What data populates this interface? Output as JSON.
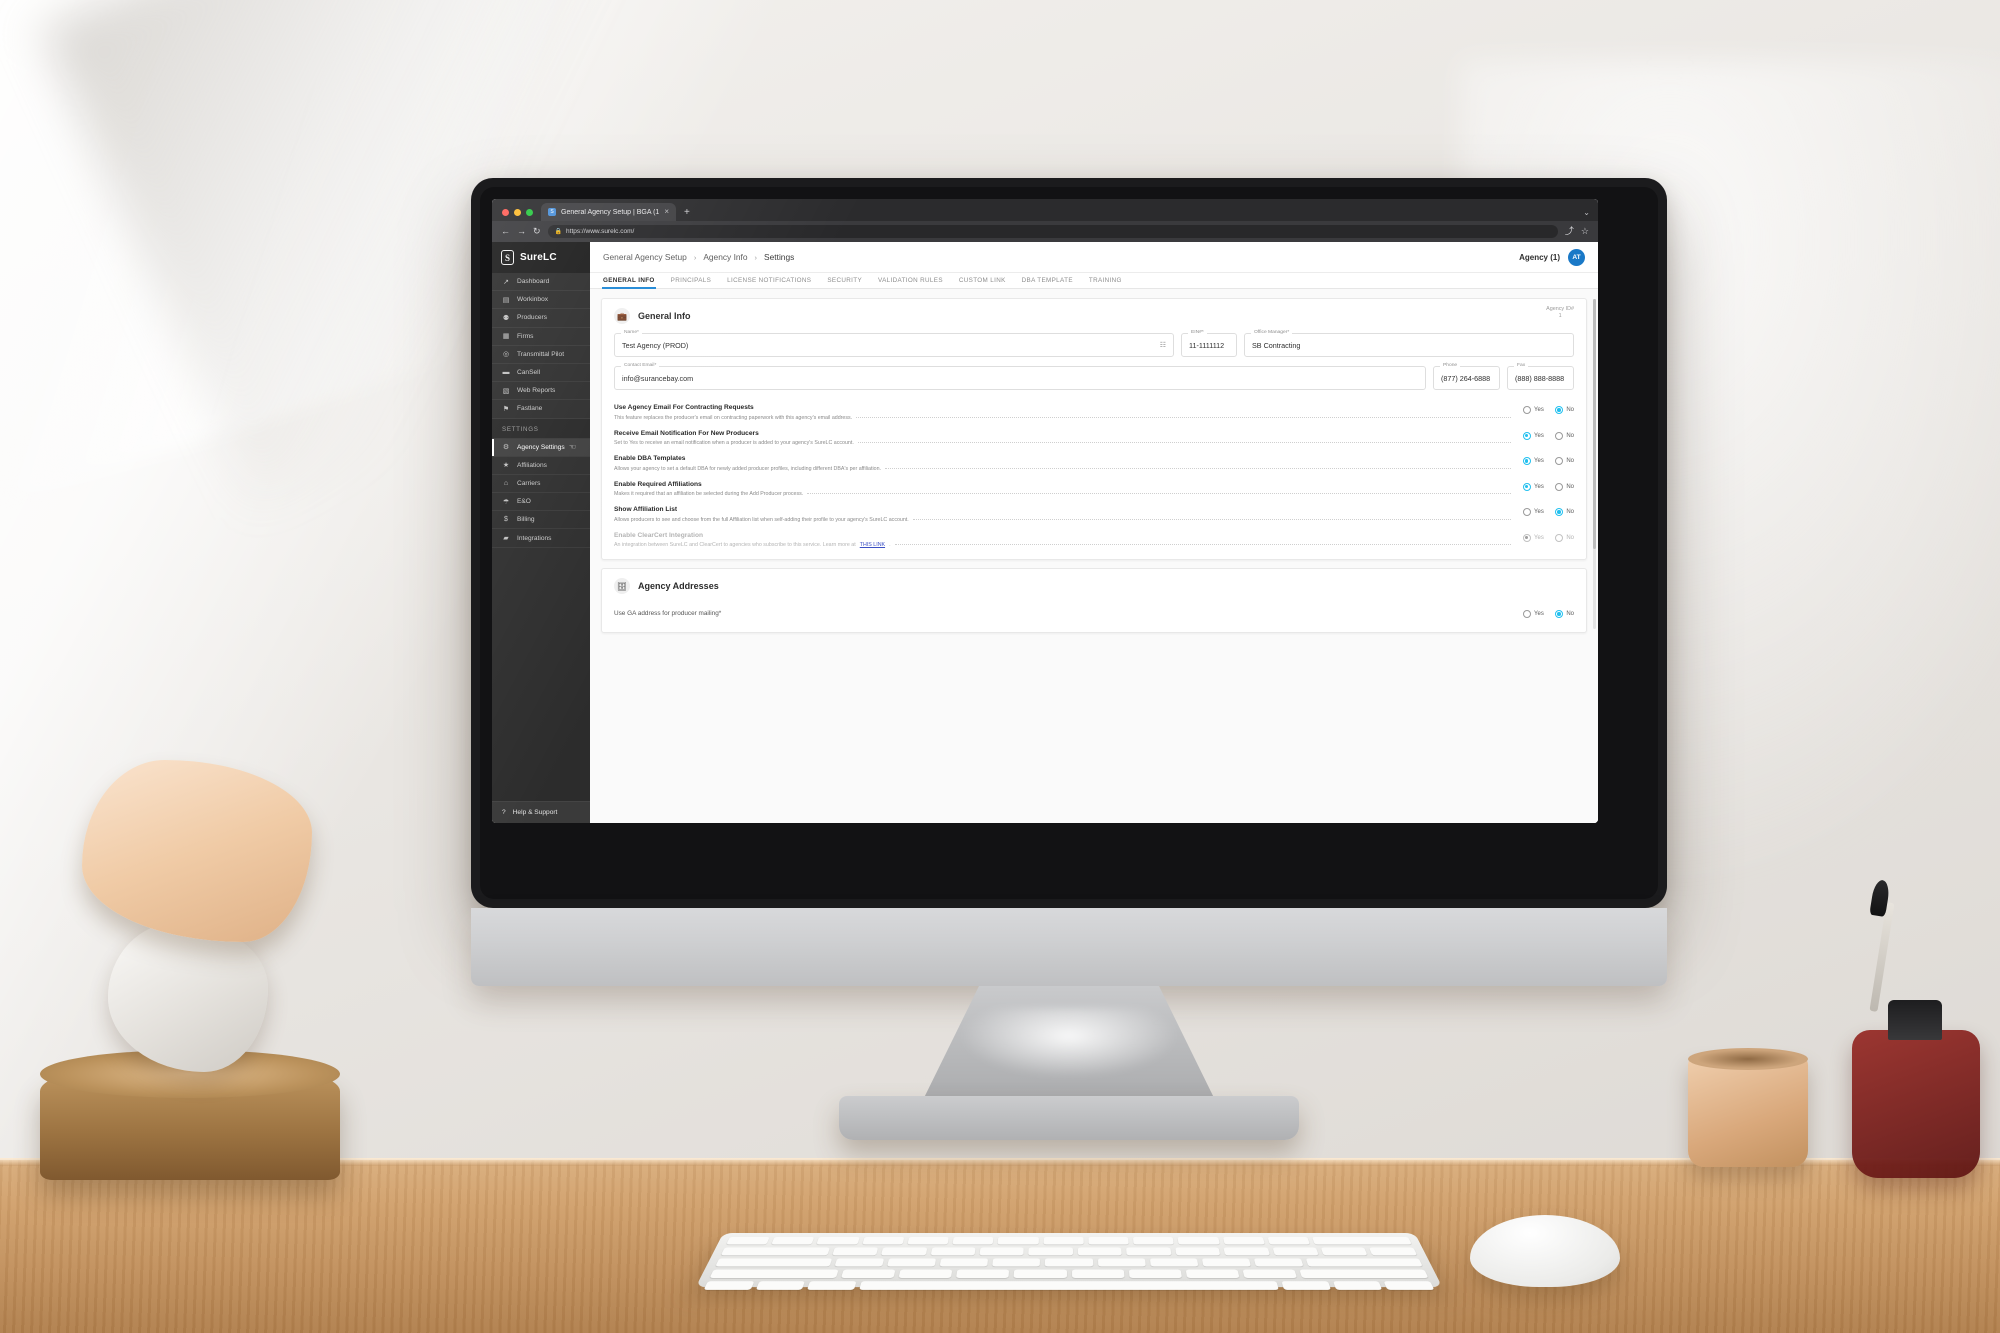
{
  "browser": {
    "tab_title": "General Agency Setup | BGA (1",
    "tab_close": "×",
    "new_tab": "+",
    "tab_list_chevron": "⌄",
    "back": "←",
    "forward": "→",
    "reload": "↻",
    "lock": "🔒",
    "url": "https://www.surelc.com/",
    "share": "⤴",
    "bookmark": "☆"
  },
  "sidebar": {
    "brand": "SureLC",
    "brand_mark": "S",
    "items": [
      {
        "label": "Dashboard",
        "icon": "↗"
      },
      {
        "label": "Workinbox",
        "icon": "▤"
      },
      {
        "label": "Producers",
        "icon": "⚉"
      },
      {
        "label": "Firms",
        "icon": "▦"
      },
      {
        "label": "Transmittal Pilot",
        "icon": "◎"
      },
      {
        "label": "CanSell",
        "icon": "▬"
      },
      {
        "label": "Web Reports",
        "icon": "▧"
      },
      {
        "label": "Fastlane",
        "icon": "⚑"
      }
    ],
    "section_label": "SETTINGS",
    "settings_items": [
      {
        "label": "Agency Settings",
        "icon": "⚙",
        "active": true
      },
      {
        "label": "Affiliations",
        "icon": "★",
        "active": false
      },
      {
        "label": "Carriers",
        "icon": "⌂",
        "active": false
      },
      {
        "label": "E&O",
        "icon": "☂",
        "active": false
      },
      {
        "label": "Billing",
        "icon": "$",
        "active": false
      },
      {
        "label": "Integrations",
        "icon": "▰",
        "active": false
      }
    ],
    "footer": {
      "label": "Help & Support",
      "icon": "?"
    }
  },
  "topbar": {
    "breadcrumb": [
      "General Agency Setup",
      "Agency Info",
      "Settings"
    ],
    "separator": "›",
    "agency_label": "Agency (1)",
    "avatar_initials": "AT"
  },
  "tabs": [
    {
      "label": "GENERAL INFO",
      "active": true
    },
    {
      "label": "PRINCIPALS",
      "active": false
    },
    {
      "label": "LICENSE NOTIFICATIONS",
      "active": false
    },
    {
      "label": "SECURITY",
      "active": false
    },
    {
      "label": "VALIDATION RULES",
      "active": false
    },
    {
      "label": "CUSTOM LINK",
      "active": false
    },
    {
      "label": "DBA TEMPLATE",
      "active": false
    },
    {
      "label": "TRAINING",
      "active": false
    }
  ],
  "general_info": {
    "section_title": "General Info",
    "section_icon": "💼",
    "agency_id_label": "Agency ID#",
    "agency_id_value": "1",
    "fields": {
      "name": {
        "label": "Name",
        "required": "*",
        "value": "Test Agency (PROD)",
        "trailing_icon": "☷"
      },
      "ein": {
        "label": "EIN#",
        "required": "*",
        "value": "11-1111112"
      },
      "office_manager": {
        "label": "Office Manager",
        "required": "*",
        "value": "SB Contracting"
      },
      "contact_email": {
        "label": "Contact Email",
        "required": "*",
        "value": "info@surancebay.com"
      },
      "phone": {
        "label": "Phone",
        "required": "",
        "value": "(877) 264-6888"
      },
      "fax": {
        "label": "Fax",
        "required": "",
        "value": "(888) 888-8888"
      }
    },
    "toggles": [
      {
        "title": "Use Agency Email For Contracting Requests",
        "desc": "This feature replaces the producer's email on contracting paperwork with this agency's email address.",
        "yes_label": "Yes",
        "no_label": "No",
        "selected": "No",
        "disabled": false
      },
      {
        "title": "Receive Email Notification For New Producers",
        "desc": "Set to Yes to receive an email notification when a producer is added to your agency's SureLC account.",
        "yes_label": "Yes",
        "no_label": "No",
        "selected": "Yes",
        "disabled": false
      },
      {
        "title": "Enable DBA Templates",
        "desc": "Allows your agency to set a default DBA for newly added producer profiles, including different DBA's per affiliation.",
        "yes_label": "Yes",
        "no_label": "No",
        "selected": "Yes",
        "disabled": false
      },
      {
        "title": "Enable Required Affiliations",
        "desc": "Makes it required that an affiliation be selected during the Add Producer process.",
        "yes_label": "Yes",
        "no_label": "No",
        "selected": "Yes",
        "disabled": false
      },
      {
        "title": "Show Affiliation List",
        "desc": "Allows producers to see and choose from the full Affiliation list when self-adding their profile to your agency's SureLC account.",
        "yes_label": "Yes",
        "no_label": "No",
        "selected": "No",
        "disabled": false
      },
      {
        "title": "Enable ClearCert Integration",
        "desc": "An integration between SureLC and ClearCert to agencies who subscribe to this service. Learn more at ",
        "desc_link": "THIS LINK",
        "desc_tail": ".",
        "yes_label": "Yes",
        "no_label": "No",
        "selected": "Yes",
        "disabled": true
      }
    ]
  },
  "agency_addresses": {
    "section_title": "Agency Addresses",
    "section_icon": "☷",
    "question": "Use GA address for producer mailing*",
    "yes_label": "Yes",
    "no_label": "No",
    "selected": "No"
  },
  "colors": {
    "accent_blue": "#22c0ef",
    "tab_underline": "#1e88d6",
    "avatar_blue": "#1a79c7",
    "sidebar_bg": "#2c2c2c",
    "link": "#3b4fc4"
  }
}
